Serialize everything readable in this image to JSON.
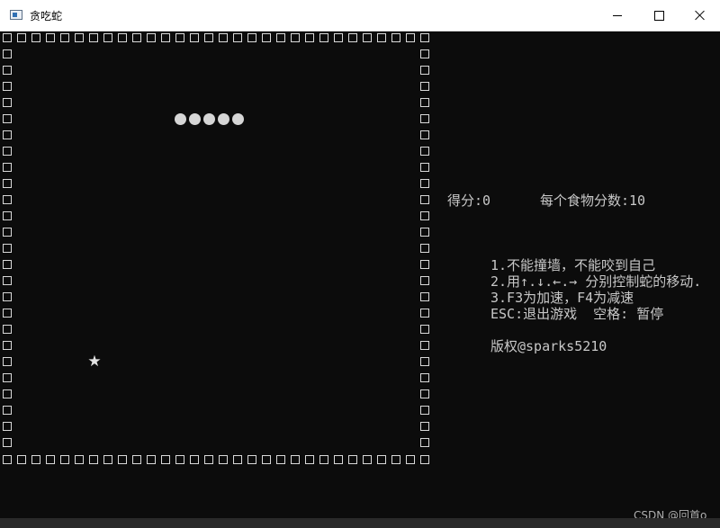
{
  "window": {
    "title": "贪吃蛇",
    "icon": "console-app-icon",
    "controls": [
      "minimize-icon",
      "maximize-icon",
      "close-icon"
    ]
  },
  "game": {
    "wall_glyph": "□",
    "snake_glyph": "●",
    "snake_length": 5,
    "food_glyph": "★",
    "text_color": "#c8c8c8",
    "background": "#0c0c0c"
  },
  "score": {
    "score_text": "得分:0",
    "per_food_text": "每个食物分数:10"
  },
  "instructions": [
    "1.不能撞墙，不能咬到自己",
    "2.用↑.↓.←.→ 分别控制蛇的移动.",
    "3.F3为加速，F4为减速",
    "ESC:退出游戏  空格: 暂停"
  ],
  "copyright": "版权@sparks5210",
  "watermark": "CSDN @回首o"
}
